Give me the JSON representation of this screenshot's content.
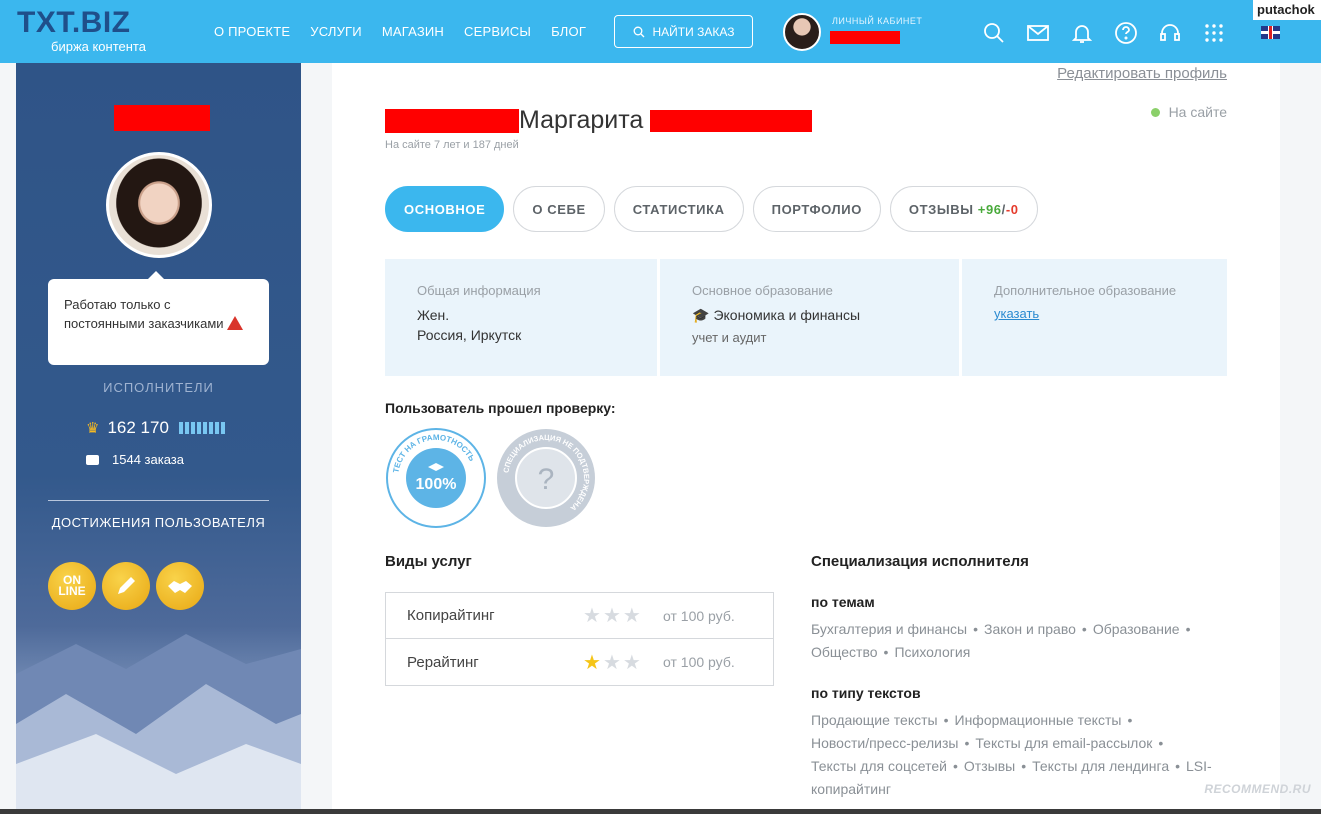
{
  "header": {
    "logo": "TXT.BIZ",
    "logo_sub": "биржа контента",
    "nav": [
      "О ПРОЕКТЕ",
      "УСЛУГИ",
      "МАГАЗИН",
      "СЕРВИСЫ",
      "БЛОГ"
    ],
    "find_button": "НАЙТИ ЗАКАЗ",
    "cabinet_label": "ЛИЧНЫЙ КАБИНЕТ",
    "corner_tag": "putachok"
  },
  "sidebar": {
    "bubble_text": "Работаю только с постоянными заказчиками",
    "category": "ИСПОЛНИТЕЛИ",
    "rating": "162 170",
    "orders": "1544 заказа",
    "achievements_title": "ДОСТИЖЕНИЯ ПОЛЬЗОВАТЕЛЯ",
    "badges": [
      "ON LINE",
      "",
      ""
    ]
  },
  "profile": {
    "edit_link": "Редактировать профиль",
    "status": "На сайте",
    "first_name": "Маргарита",
    "since": "На сайте 7 лет и 187 дней",
    "tabs": [
      "ОСНОВНОЕ",
      "О СЕБЕ",
      "СТАТИСТИКА",
      "ПОРТФОЛИО",
      "ОТЗЫВЫ"
    ],
    "reviews_pos": "+96",
    "reviews_sep": "/",
    "reviews_neg": "-0"
  },
  "info": {
    "general_label": "Общая информация",
    "gender": "Жен.",
    "location": "Россия, Иркутск",
    "edu_label": "Основное образование",
    "edu_value": "Экономика и финансы",
    "edu_sub": "учет и аудит",
    "extra_label": "Дополнительное образование",
    "extra_link": "указать"
  },
  "verification": {
    "title": "Пользователь прошел проверку:",
    "stamp1_ring": "ТЕСТ НА ГРАМОТНОСТЬ",
    "stamp1_value": "100%",
    "stamp2_ring": "СПЕЦИАЛИЗАЦИЯ НЕ ПОДТВЕРЖДЕНА"
  },
  "services": {
    "title": "Виды услуг",
    "rows": [
      {
        "name": "Копирайтинг",
        "stars": 0,
        "price": "от 100 руб."
      },
      {
        "name": "Рерайтинг",
        "stars": 1,
        "price": "от 100 руб."
      }
    ]
  },
  "specialization": {
    "title": "Специализация исполнителя",
    "topics_title": "по темам",
    "topics": [
      "Бухгалтерия и финансы",
      "Закон и право",
      "Образование",
      "Общество",
      "Психология"
    ],
    "types_title": "по типу текстов",
    "types": [
      "Продающие тексты",
      "Информационные тексты",
      "Новости/пресс-релизы",
      "Тексты для email-рассылок",
      "Тексты для соцсетей",
      "Отзывы",
      "Тексты для лендинга",
      "LSI-копирайтинг"
    ]
  },
  "watermark": "RECOMMEND.RU"
}
